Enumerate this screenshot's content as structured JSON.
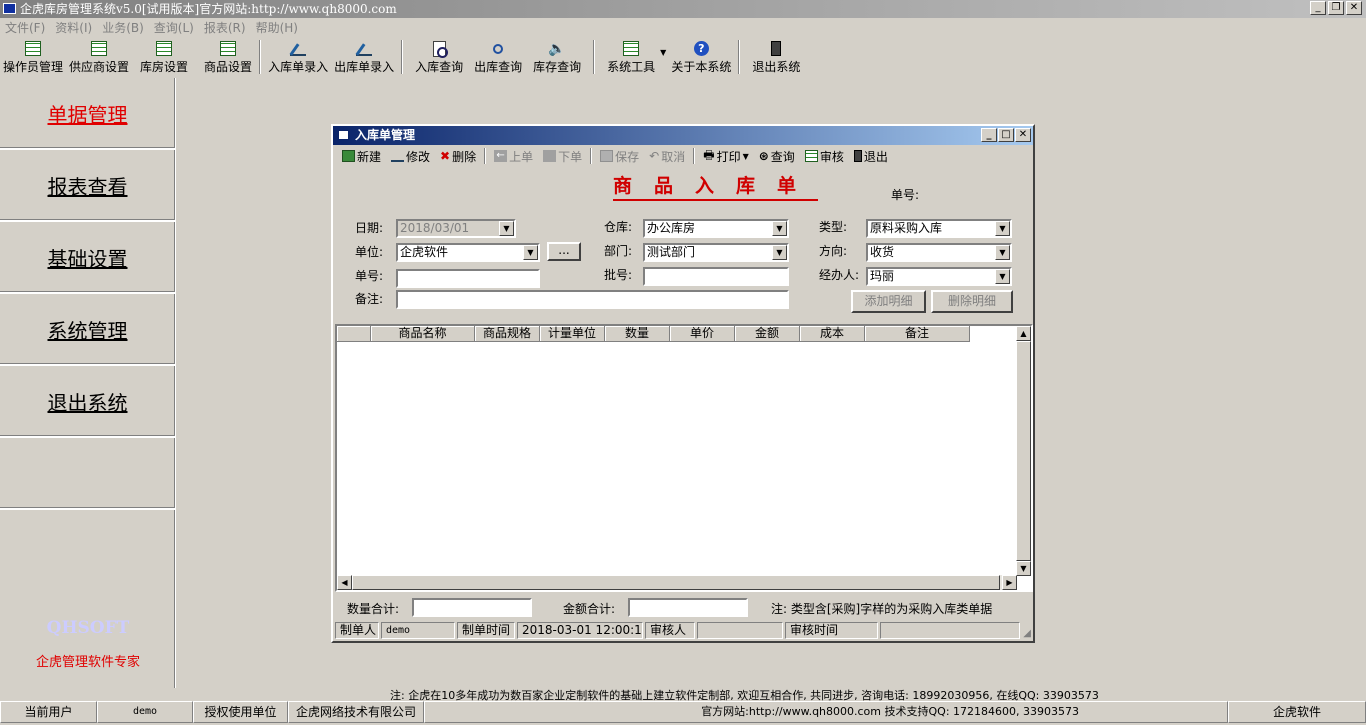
{
  "window": {
    "title": "企虎库房管理系统v5.0[试用版本]官方网站:http://www.qh8000.com"
  },
  "menu": [
    "文件(F)",
    "资料(I)",
    "业务(B)",
    "查询(L)",
    "报表(R)",
    "帮助(H)"
  ],
  "toolbar": [
    "操作员管理",
    "供应商设置",
    "库房设置",
    "商品设置",
    "入库单录入",
    "出库单录入",
    "入库查询",
    "出库查询",
    "库存查询",
    "系统工具",
    "关于本系统",
    "退出系统"
  ],
  "sidebar": {
    "items": [
      "单据管理",
      "报表查看",
      "基础设置",
      "系统管理",
      "退出系统"
    ],
    "brand_en": "QHSOFT",
    "brand_cn": "企虎管理软件专家"
  },
  "dialog": {
    "title": "入库单管理",
    "tools": {
      "new": "新建",
      "edit": "修改",
      "delete": "删除",
      "prev": "上单",
      "next": "下单",
      "save": "保存",
      "cancel": "取消",
      "print": "打印",
      "query": "查询",
      "audit": "审核",
      "exit": "退出"
    },
    "form_title": "商品入库单",
    "number_label": "单号:",
    "fields": {
      "date_label": "日期:",
      "date_value": "2018/03/01",
      "unit_label": "单位:",
      "unit_value": "企虎软件",
      "no_label": "单号:",
      "no_value": "",
      "remark_label": "备注:",
      "remark_value": "",
      "warehouse_label": "仓库:",
      "warehouse_value": "办公库房",
      "dept_label": "部门:",
      "dept_value": "测试部门",
      "batch_label": "批号:",
      "batch_value": "",
      "type_label": "类型:",
      "type_value": "原料采购入库",
      "direction_label": "方向:",
      "direction_value": "收货",
      "handler_label": "经办人:",
      "handler_value": "玛丽",
      "ellipsis": "..."
    },
    "buttons": {
      "add_detail": "添加明细",
      "del_detail": "删除明细"
    },
    "columns": [
      "",
      "商品名称",
      "商品规格",
      "计量单位",
      "数量",
      "单价",
      "金额",
      "成本",
      "备注"
    ],
    "totals": {
      "qty_label": "数量合计:",
      "amount_label": "金额合计:",
      "note": "注: 类型含[采购]字样的为采购入库类单据"
    },
    "status": {
      "maker_label": "制单人",
      "maker": "demo",
      "make_time_label": "制单时间",
      "make_time": "2018-03-01 12:00:16",
      "auditor_label": "审核人",
      "auditor": "",
      "audit_time_label": "审核时间",
      "audit_time": ""
    }
  },
  "footer_note": "注: 企虎在10多年成功为数百家企业定制软件的基础上建立软件定制部, 欢迎互相合作, 共同进步, 咨询电话: 18992030956,  在线QQ: 33903573",
  "bottom": {
    "user_label": "当前用户",
    "user": "demo",
    "licensee_label": "授权使用单位",
    "licensee": "企虎网络技术有限公司",
    "site": "官方网站:http://www.qh8000.com 技术支持QQ: 172184600, 33903573",
    "company": "企虎软件"
  }
}
